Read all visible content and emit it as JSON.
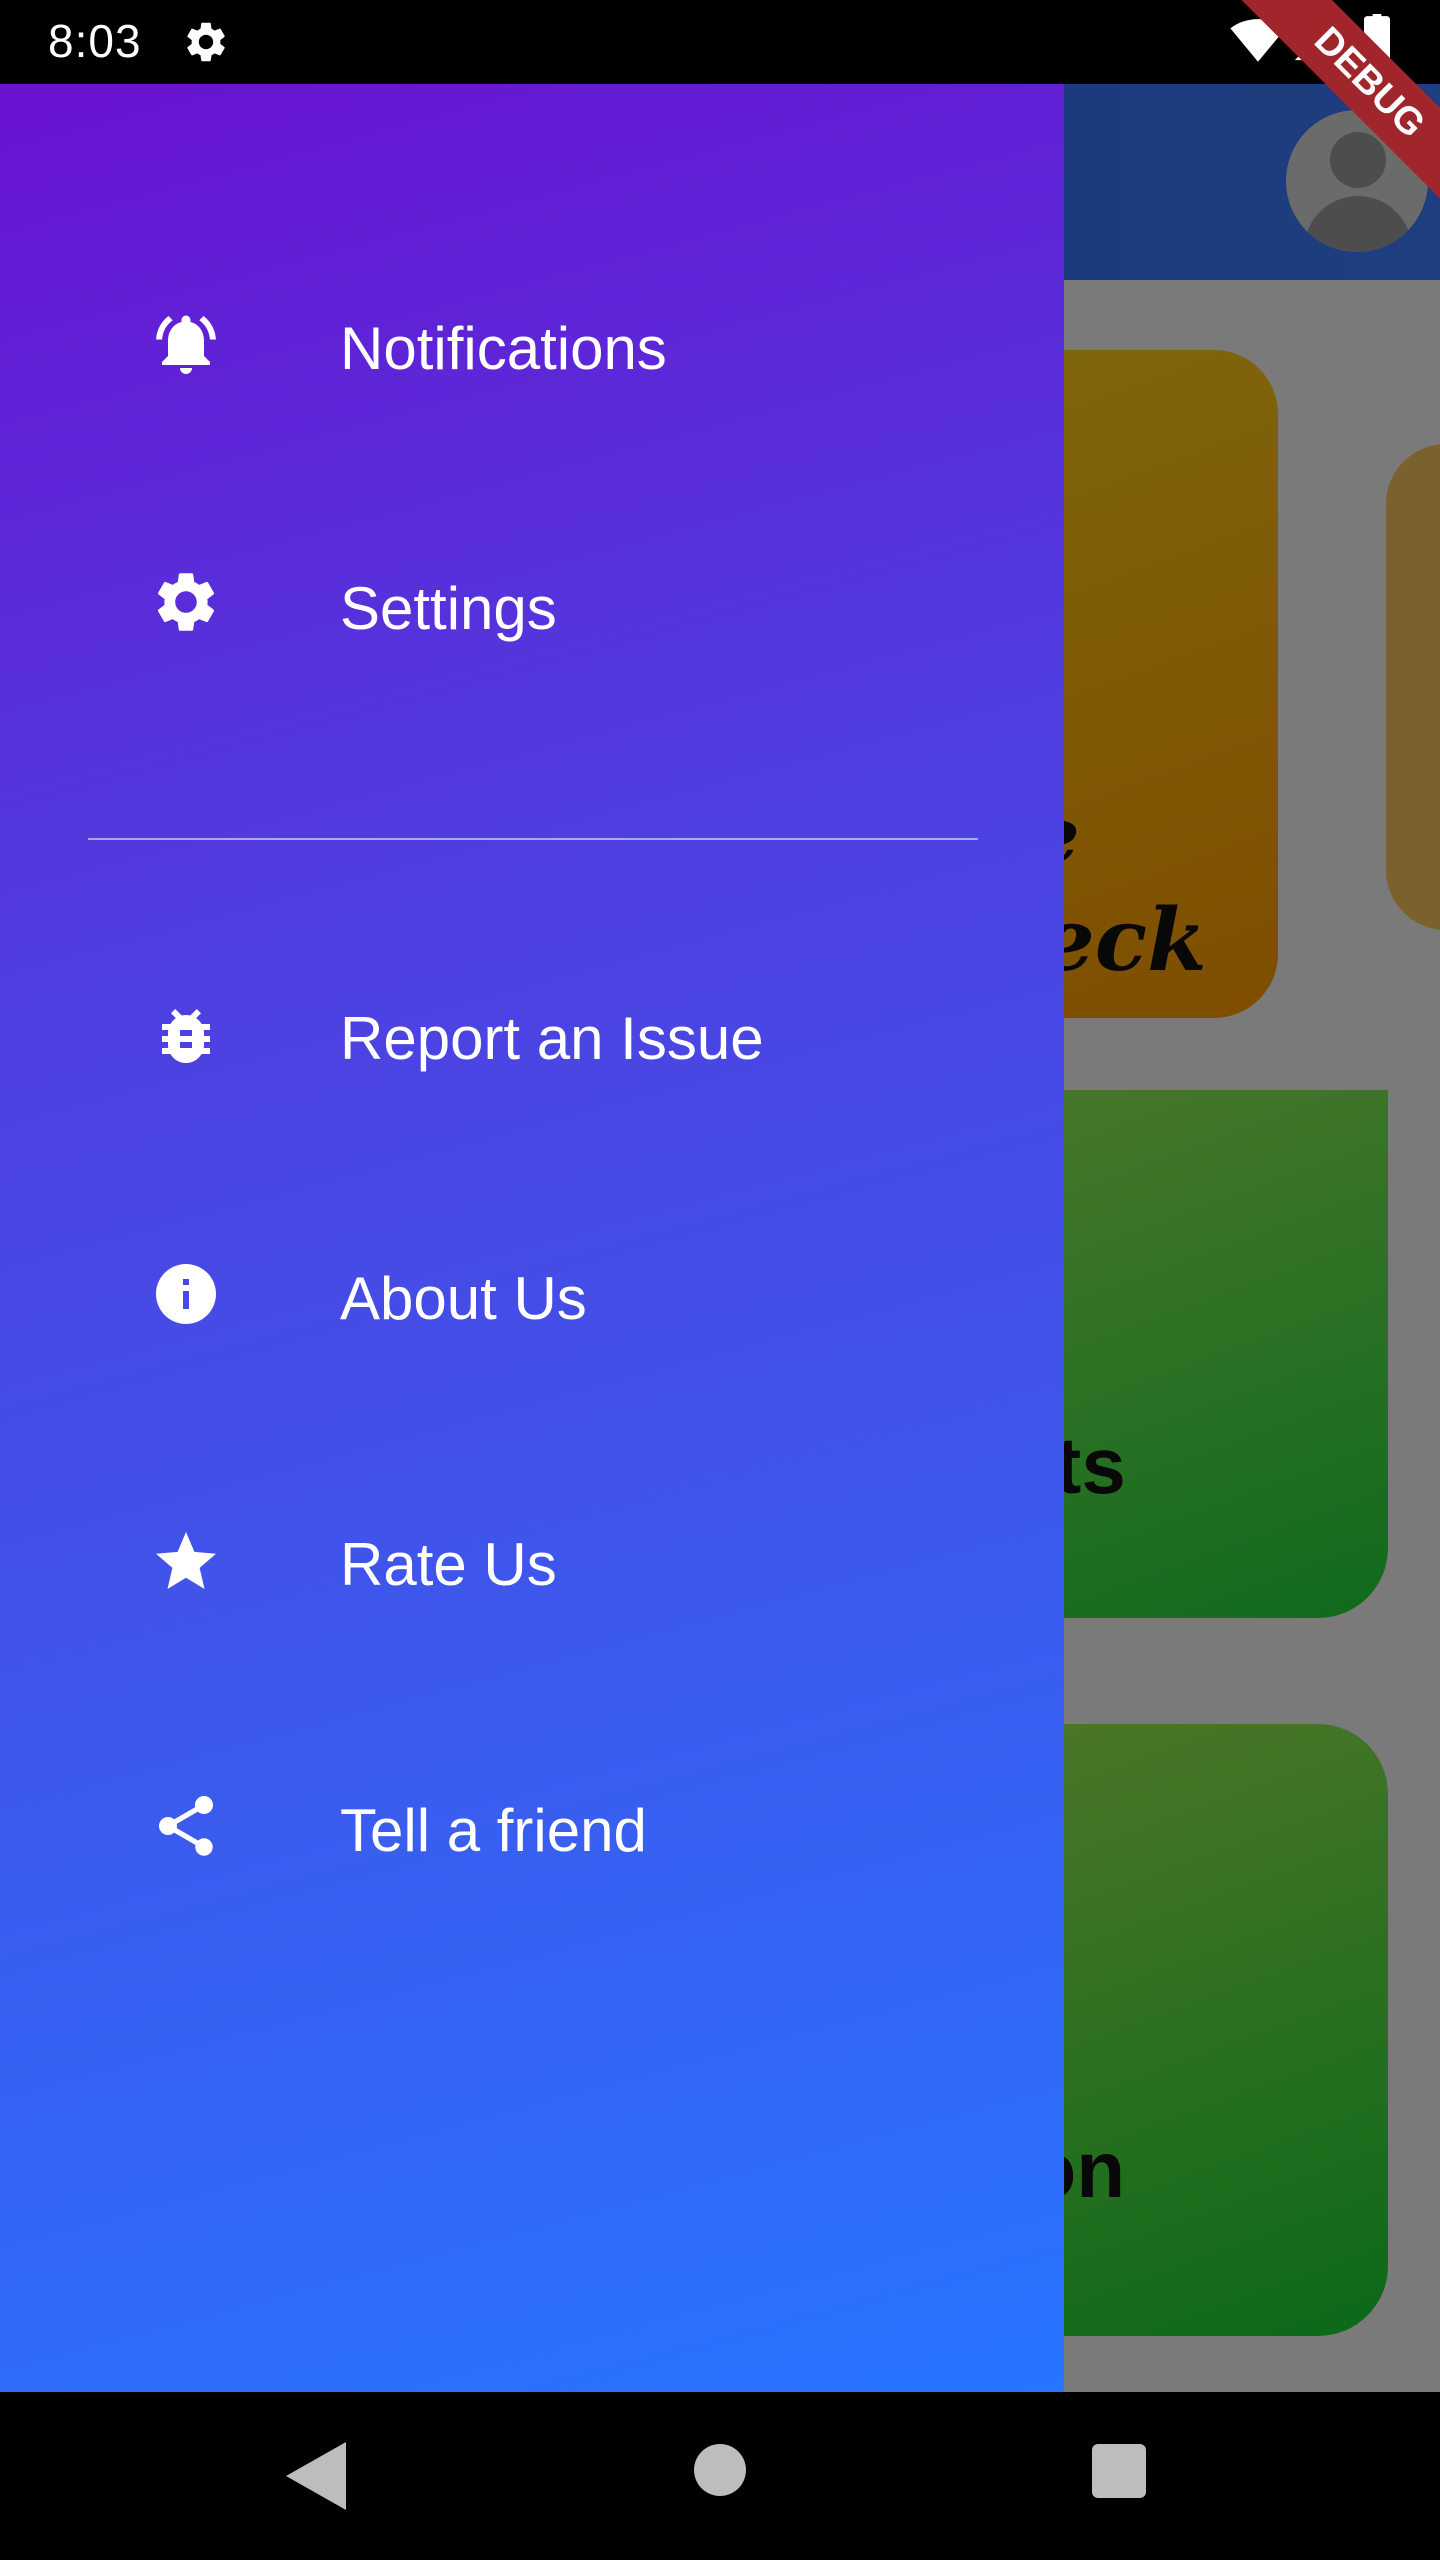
{
  "status_bar": {
    "time": "8:03"
  },
  "debug_banner": "DEBUG",
  "drawer": {
    "items_top": [
      {
        "label": "Notifications",
        "icon": "bell-ringing-icon"
      },
      {
        "label": "Settings",
        "icon": "gear-icon"
      }
    ],
    "items_bottom": [
      {
        "label": "Report an Issue",
        "icon": "bug-icon"
      },
      {
        "label": "About Us",
        "icon": "info-icon"
      },
      {
        "label": "Rate Us",
        "icon": "star-icon"
      },
      {
        "label": "Tell a friend",
        "icon": "share-icon"
      }
    ]
  },
  "background": {
    "card1_text_line1": "e",
    "card1_text_line2": "eck",
    "card2_text": "plaints",
    "card3_text": "g Soon"
  },
  "colors": {
    "drawer_top": "#6a12d0",
    "drawer_bottom": "#2875ff",
    "header": "#2d64ff",
    "card_orange": "#ffb300",
    "card_green": "#3bd84a"
  }
}
